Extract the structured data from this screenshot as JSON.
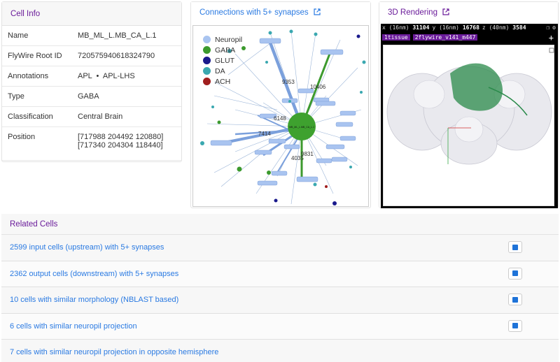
{
  "cell_info": {
    "title": "Cell Info",
    "rows": [
      {
        "key": "Name",
        "value": "MB_ML_L.MB_CA_L.1"
      },
      {
        "key": "FlyWire Root ID",
        "value": "720575940618324790"
      },
      {
        "key": "Annotations",
        "value": "APL  •  APL-LHS"
      },
      {
        "key": "Type",
        "value": "GABA"
      },
      {
        "key": "Classification",
        "value": "Central Brain"
      },
      {
        "key": "Position",
        "value": "[717988 204492 120880]",
        "value2": "[717340 204304 118440]"
      }
    ]
  },
  "connections": {
    "title": "Connections with 5+ synapses",
    "external_icon": "external-link-icon",
    "legend": [
      {
        "label": "Neuropil",
        "color": "#a9c4f0"
      },
      {
        "label": "GABA",
        "color": "#3c9a2e"
      },
      {
        "label": "GLUT",
        "color": "#1a1a8c"
      },
      {
        "label": "DA",
        "color": "#3aa8b0"
      },
      {
        "label": "ACH",
        "color": "#a01e1e"
      }
    ],
    "edge_labels": [
      "9353",
      "10406",
      "6148",
      "7414",
      "9831",
      "4035"
    ],
    "center_label": "MB_ML_L.MB_CA_L.1"
  },
  "rendering": {
    "title": "3D Rendering",
    "external_icon": "external-link-icon",
    "toolbar": {
      "x_unit": "x (16nm)",
      "x_val": "31104",
      "y_unit": "y (16nm)",
      "y_val": "16768",
      "z_unit": "z (40nm)",
      "z_val": "3584"
    },
    "layers": {
      "layer1": "1tissue",
      "layer2": "2flywire_v141_m447",
      "add": "+"
    }
  },
  "related": {
    "title": "Related Cells",
    "items": [
      {
        "label": "2599 input cells (upstream) with 5+ synapses"
      },
      {
        "label": "2362 output cells (downstream) with 5+ synapses"
      },
      {
        "label": "10 cells with similar morphology (NBLAST based)"
      },
      {
        "label": "6 cells with similar neuropil projection"
      },
      {
        "label": "7 cells with similar neuropil projection in opposite hemisphere"
      }
    ]
  }
}
